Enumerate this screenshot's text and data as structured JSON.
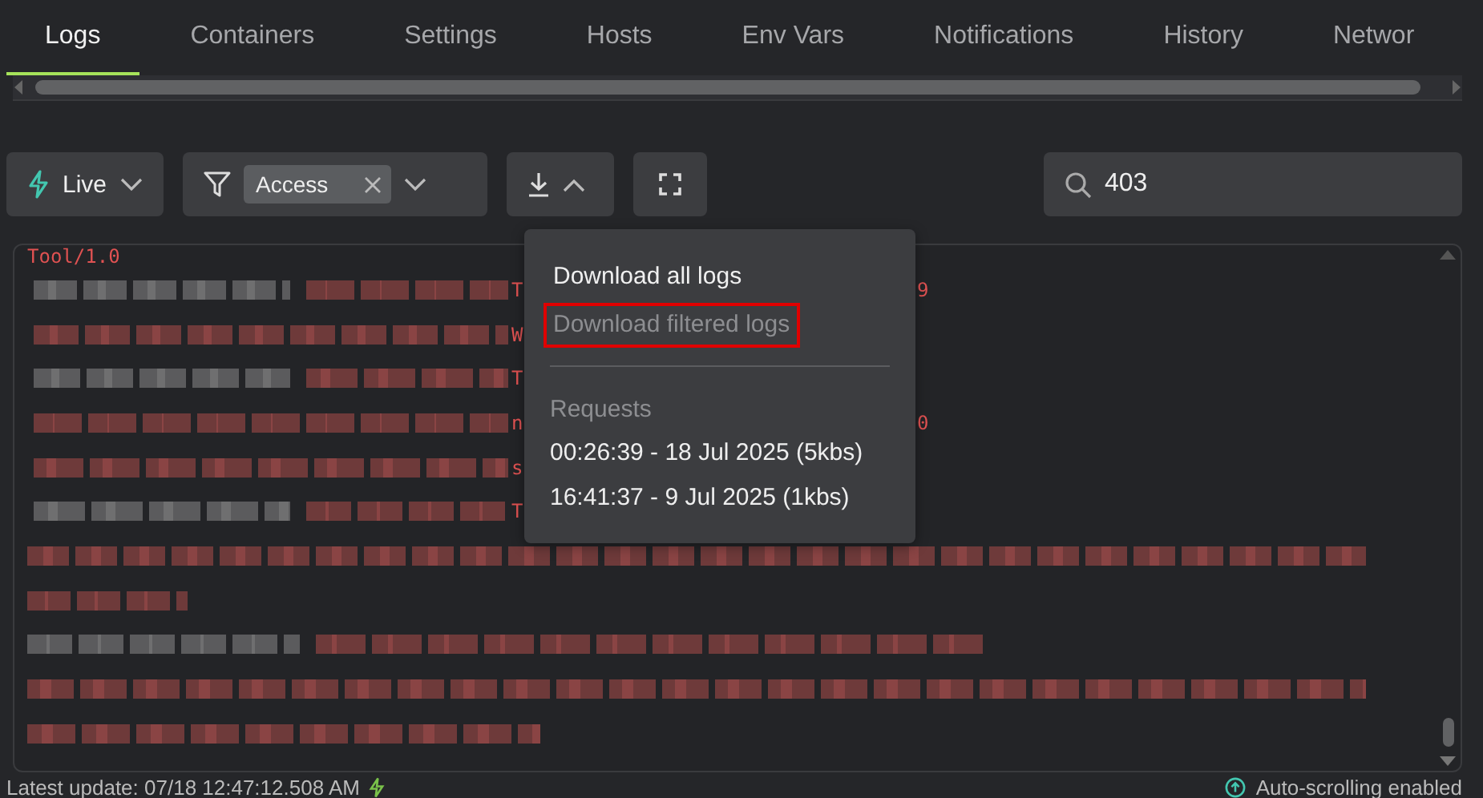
{
  "tabs": [
    {
      "label": "Logs",
      "selected": true
    },
    {
      "label": "Containers",
      "selected": false
    },
    {
      "label": "Settings",
      "selected": false
    },
    {
      "label": "Hosts",
      "selected": false
    },
    {
      "label": "Env Vars",
      "selected": false
    },
    {
      "label": "Notifications",
      "selected": false
    },
    {
      "label": "History",
      "selected": false
    },
    {
      "label": "Networ",
      "selected": false
    }
  ],
  "toolbar": {
    "mode": "Live",
    "filter_chip": "Access",
    "search": {
      "value": "403"
    }
  },
  "download_menu": {
    "items": [
      {
        "label": "Download all logs",
        "disabled": false,
        "highlighted": false
      },
      {
        "label": "Download filtered logs",
        "disabled": true,
        "highlighted": true
      }
    ],
    "section_label": "Requests",
    "requests": [
      "00:26:39 - 18 Jul 2025 (5kbs)",
      "16:41:37 - 9 Jul 2025 (1kbs)"
    ]
  },
  "log": {
    "lines": [
      {
        "kind": "text",
        "text": "Tool/1.0"
      },
      {
        "kind": "mixed",
        "lead": "T",
        "trail": "9"
      },
      {
        "kind": "red",
        "lead": "W"
      },
      {
        "kind": "mixed",
        "lead": "T"
      },
      {
        "kind": "red",
        "lead": "n",
        "trail": "0"
      },
      {
        "kind": "red",
        "lead": "s"
      },
      {
        "kind": "mixed",
        "lead": "T"
      },
      {
        "kind": "red"
      },
      {
        "kind": "red"
      },
      {
        "kind": "mixed"
      },
      {
        "kind": "red"
      },
      {
        "kind": "red"
      }
    ]
  },
  "status_bar": {
    "latest_update": "Latest update: 07/18 12:47:12.508 AM",
    "autoscroll": "Auto-scrolling enabled"
  }
}
